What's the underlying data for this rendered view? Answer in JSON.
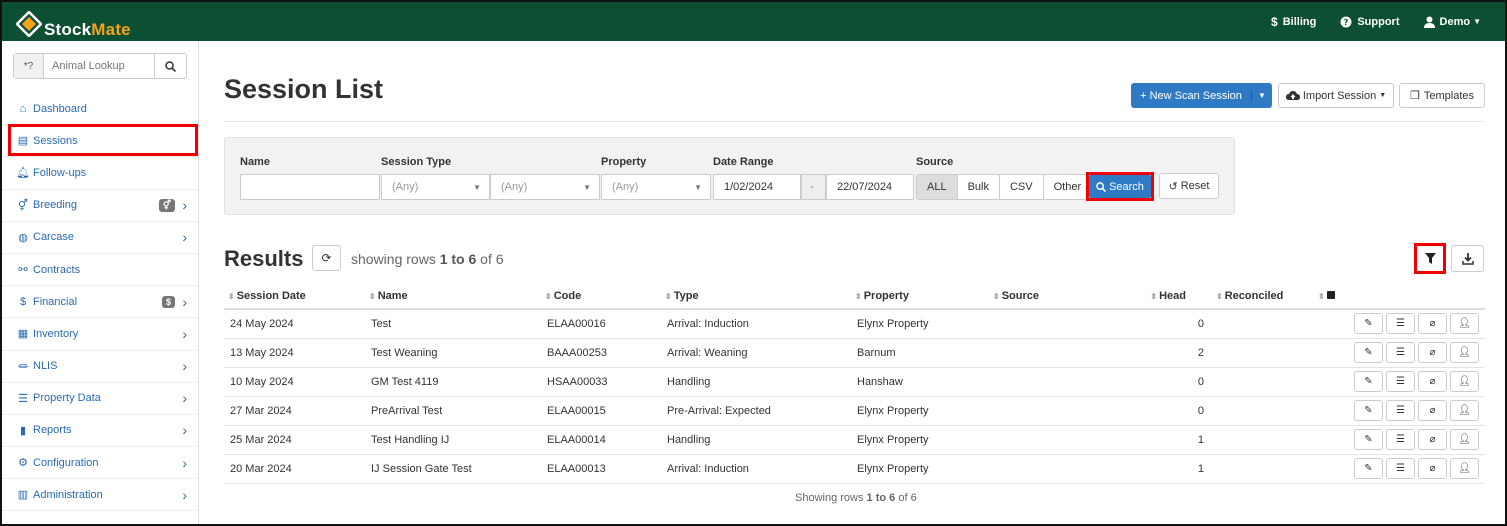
{
  "app": {
    "name_part1": "Stock",
    "name_part2": "Mate"
  },
  "topnav": {
    "billing": "Billing",
    "support": "Support",
    "user": "Demo"
  },
  "sidebar": {
    "lookup_prefix": "*?",
    "lookup_placeholder": "Animal Lookup",
    "items": [
      {
        "label": "Dashboard",
        "icon": "home-icon"
      },
      {
        "label": "Sessions",
        "icon": "table-icon"
      },
      {
        "label": "Follow-ups",
        "icon": "bell-icon"
      },
      {
        "label": "Breeding",
        "icon": "gender-icon",
        "badge": "⚥"
      },
      {
        "label": "Carcase",
        "icon": "carcase-icon"
      },
      {
        "label": "Contracts",
        "icon": "handshake-icon"
      },
      {
        "label": "Financial",
        "icon": "dollar-icon",
        "badge": "$"
      },
      {
        "label": "Inventory",
        "icon": "boxes-icon"
      },
      {
        "label": "NLIS",
        "icon": "bank-icon"
      },
      {
        "label": "Property Data",
        "icon": "sliders-icon"
      },
      {
        "label": "Reports",
        "icon": "chart-icon"
      },
      {
        "label": "Configuration",
        "icon": "gear-icon"
      },
      {
        "label": "Administration",
        "icon": "building-icon"
      }
    ]
  },
  "page": {
    "title": "Session List",
    "new_session": "New Scan Session",
    "import_session": "Import Session",
    "templates": "Templates"
  },
  "filters": {
    "name_label": "Name",
    "name_value": "",
    "session_type_label": "Session Type",
    "session_type_1": "(Any)",
    "session_type_2": "(Any)",
    "property_label": "Property",
    "property_value": "(Any)",
    "date_range_label": "Date Range",
    "date_from": "1/02/2024",
    "date_sep": "-",
    "date_to": "22/07/2024",
    "source_label": "Source",
    "source_options": [
      "ALL",
      "Bulk",
      "CSV",
      "Other"
    ],
    "source_selected": "ALL",
    "search": "Search",
    "reset": "Reset"
  },
  "results": {
    "title": "Results",
    "showing_pre": "showing rows ",
    "showing_range": "1 to 6",
    "showing_post": " of 6",
    "columns": [
      "Session Date",
      "Name",
      "Code",
      "Type",
      "Property",
      "Source",
      "Head",
      "Reconciled"
    ],
    "rows": [
      {
        "date": "24 May 2024",
        "name": "Test",
        "code": "ELAA00016",
        "type": "Arrival: Induction",
        "property": "Elynx Property",
        "source": "",
        "head": "0",
        "reconciled": ""
      },
      {
        "date": "13 May 2024",
        "name": "Test Weaning",
        "code": "BAAA00253",
        "type": "Arrival: Weaning",
        "property": "Barnum",
        "source": "",
        "head": "2",
        "reconciled": ""
      },
      {
        "date": "10 May 2024",
        "name": "GM Test 4119",
        "code": "HSAA00033",
        "type": "Handling",
        "property": "Hanshaw",
        "source": "",
        "head": "0",
        "reconciled": ""
      },
      {
        "date": "27 Mar 2024",
        "name": "PreArrival Test",
        "code": "ELAA00015",
        "type": "Pre-Arrival: Expected",
        "property": "Elynx Property",
        "source": "",
        "head": "0",
        "reconciled": ""
      },
      {
        "date": "25 Mar 2024",
        "name": "Test Handling IJ",
        "code": "ELAA00014",
        "type": "Handling",
        "property": "Elynx Property",
        "source": "",
        "head": "1",
        "reconciled": ""
      },
      {
        "date": "20 Mar 2024",
        "name": "IJ Session Gate Test",
        "code": "ELAA00013",
        "type": "Arrival: Induction",
        "property": "Elynx Property",
        "source": "",
        "head": "1",
        "reconciled": ""
      }
    ],
    "footer_pre": "Showing rows ",
    "footer_range": "1 to 6",
    "footer_post": " of 6"
  },
  "colors": {
    "topbar": "#0d4f33",
    "primary": "#2f7ac4",
    "link": "#2a6ab1",
    "highlight": "#e00000",
    "logo_accent": "#f3a21b"
  }
}
